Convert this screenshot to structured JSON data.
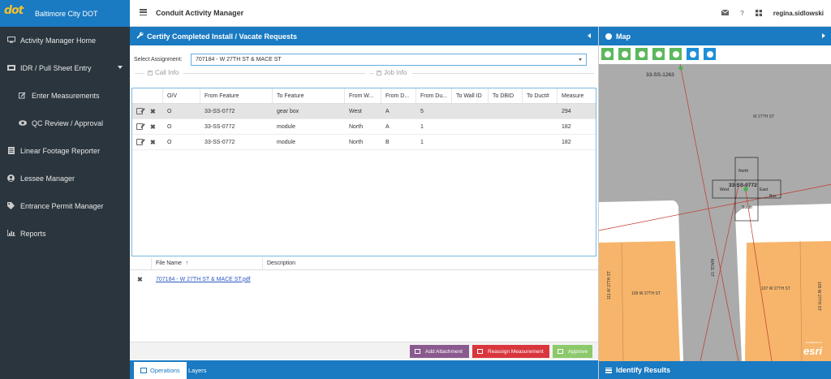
{
  "brand": {
    "logo_text": "dot",
    "name": "Baltimore City DOT"
  },
  "header": {
    "app_title": "Conduit Activity Manager",
    "icons": [
      "envelope-icon",
      "help-icon",
      "apps-grid-icon"
    ],
    "help_glyph": "?",
    "username": "regina.sidlowski"
  },
  "sidebar": {
    "items": [
      {
        "label": "Activity Manager Home",
        "icon": "monitor-icon"
      },
      {
        "label": "IDR / Pull Sheet Entry",
        "icon": "ticket-icon",
        "expanded": true
      },
      {
        "label": "Enter Measurements",
        "icon": "pencil-icon",
        "sub": true
      },
      {
        "label": "QC Review / Approval",
        "icon": "eye-icon",
        "sub": true
      },
      {
        "label": "Linear Footage Reporter",
        "icon": "document-icon"
      },
      {
        "label": "Lessee Manager",
        "icon": "user-icon"
      },
      {
        "label": "Entrance Permit Manager",
        "icon": "tag-icon"
      },
      {
        "label": "Reports",
        "icon": "bar-chart-icon"
      }
    ]
  },
  "panel": {
    "title": "Certify Completed Install / Vacate Requests",
    "assignment_label": "Select Assignment:",
    "assignment_value": "707184 - W 27TH ST & MACE ST",
    "section_call_info": "Call Info",
    "section_job_info": "Job Info"
  },
  "grid": {
    "columns": [
      "O/V",
      "From Feature",
      "To Feature",
      "From W...",
      "From D...",
      "From Du...",
      "To Wall ID",
      "To DBID",
      "To Duct#",
      "Measure"
    ],
    "rows": [
      [
        "O",
        "33-SS-0772",
        "gear box",
        "West",
        "A",
        "5",
        "",
        "",
        "",
        "294"
      ],
      [
        "O",
        "33-SS-0772",
        "module",
        "North",
        "A",
        "1",
        "",
        "",
        "",
        "182"
      ],
      [
        "O",
        "33-SS-0772",
        "module",
        "North",
        "B",
        "1",
        "",
        "",
        "",
        "182"
      ]
    ]
  },
  "files": {
    "col_file": "File Name",
    "sort_glyph": "↑",
    "col_desc": "Description",
    "rows": [
      {
        "name": "707184 - W 27TH ST & MACE ST.pdf",
        "description": ""
      }
    ]
  },
  "buttons": {
    "add_attachment": "Add Attachment",
    "reassign": "Reassign Measurement",
    "approve": "Approve"
  },
  "tabs": {
    "operations": "Operations",
    "layers": "Layers"
  },
  "map": {
    "title": "Map",
    "identify_title": "Identify Results",
    "labels": {
      "node_top": "33-SS-1263",
      "street_w27": "W 27TH ST",
      "node_center": "33-SS-0772",
      "north": "North",
      "south": "South",
      "east": "East",
      "west": "West",
      "box": "Box",
      "mace": "MACE ST",
      "lot_111": "111 W 27TH ST",
      "lot_109": "109 W 27TH ST",
      "lot_107": "107 W 27TH ST",
      "lot_105": "105 W 27TH ST",
      "esri": "esri",
      "esri_powered": "POWERED BY"
    }
  }
}
